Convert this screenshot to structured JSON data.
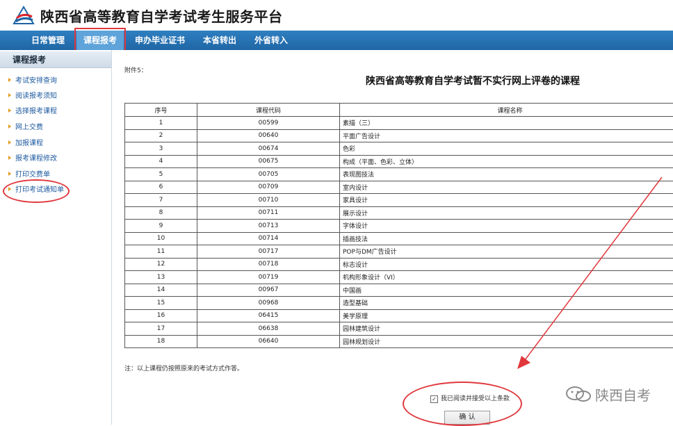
{
  "header": {
    "title": "陕西省高等教育自学考试考生服务平台"
  },
  "nav": {
    "items": [
      {
        "label": "日常管理"
      },
      {
        "label": "课程报考"
      },
      {
        "label": "申办毕业证书"
      },
      {
        "label": "本省转出"
      },
      {
        "label": "外省转入"
      }
    ],
    "active_index": 1
  },
  "sidebar": {
    "title": "课程报考",
    "items": [
      {
        "label": "考试安排查询"
      },
      {
        "label": "阅读报考须知"
      },
      {
        "label": "选择报考课程"
      },
      {
        "label": "网上交费"
      },
      {
        "label": "加报课程"
      },
      {
        "label": "报考课程修改"
      },
      {
        "label": "打印交费单"
      },
      {
        "label": "打印考试通知单"
      }
    ]
  },
  "main": {
    "attachment": "附件5：",
    "title": "陕西省高等教育自学考试暂不实行网上评卷的课程",
    "table": {
      "headers": [
        "序号",
        "课程代码",
        "课程名称"
      ],
      "rows": [
        [
          "1",
          "00599",
          "素描（三）"
        ],
        [
          "2",
          "00640",
          "平面广告设计"
        ],
        [
          "3",
          "00674",
          "色彩"
        ],
        [
          "4",
          "00675",
          "构成（平面、色彩、立体）"
        ],
        [
          "5",
          "00705",
          "表现图技法"
        ],
        [
          "6",
          "00709",
          "室内设计"
        ],
        [
          "7",
          "00710",
          "家具设计"
        ],
        [
          "8",
          "00711",
          "展示设计"
        ],
        [
          "9",
          "00713",
          "字体设计"
        ],
        [
          "10",
          "00714",
          "插画技法"
        ],
        [
          "11",
          "00717",
          "POP与DM广告设计"
        ],
        [
          "12",
          "00718",
          "标志设计"
        ],
        [
          "13",
          "00719",
          "机构形象设计（VI）"
        ],
        [
          "14",
          "00967",
          "中国画"
        ],
        [
          "15",
          "00968",
          "造型基础"
        ],
        [
          "16",
          "06415",
          "美学原理"
        ],
        [
          "17",
          "06638",
          "园林建筑设计"
        ],
        [
          "18",
          "06640",
          "园林规划设计"
        ]
      ]
    },
    "note": "注：以上课程仍按照原来的考试方式作答。",
    "agree_label": "我已阅读并接受以上条款",
    "agree_checked": true,
    "confirm_label": "确 认"
  },
  "watermark": {
    "text": "陕西自考"
  },
  "colors": {
    "nav_bg": "#1f66a5",
    "nav_active": "#5ea3da",
    "annotation_red": "#e0383d",
    "link_blue": "#1e5aa0"
  }
}
